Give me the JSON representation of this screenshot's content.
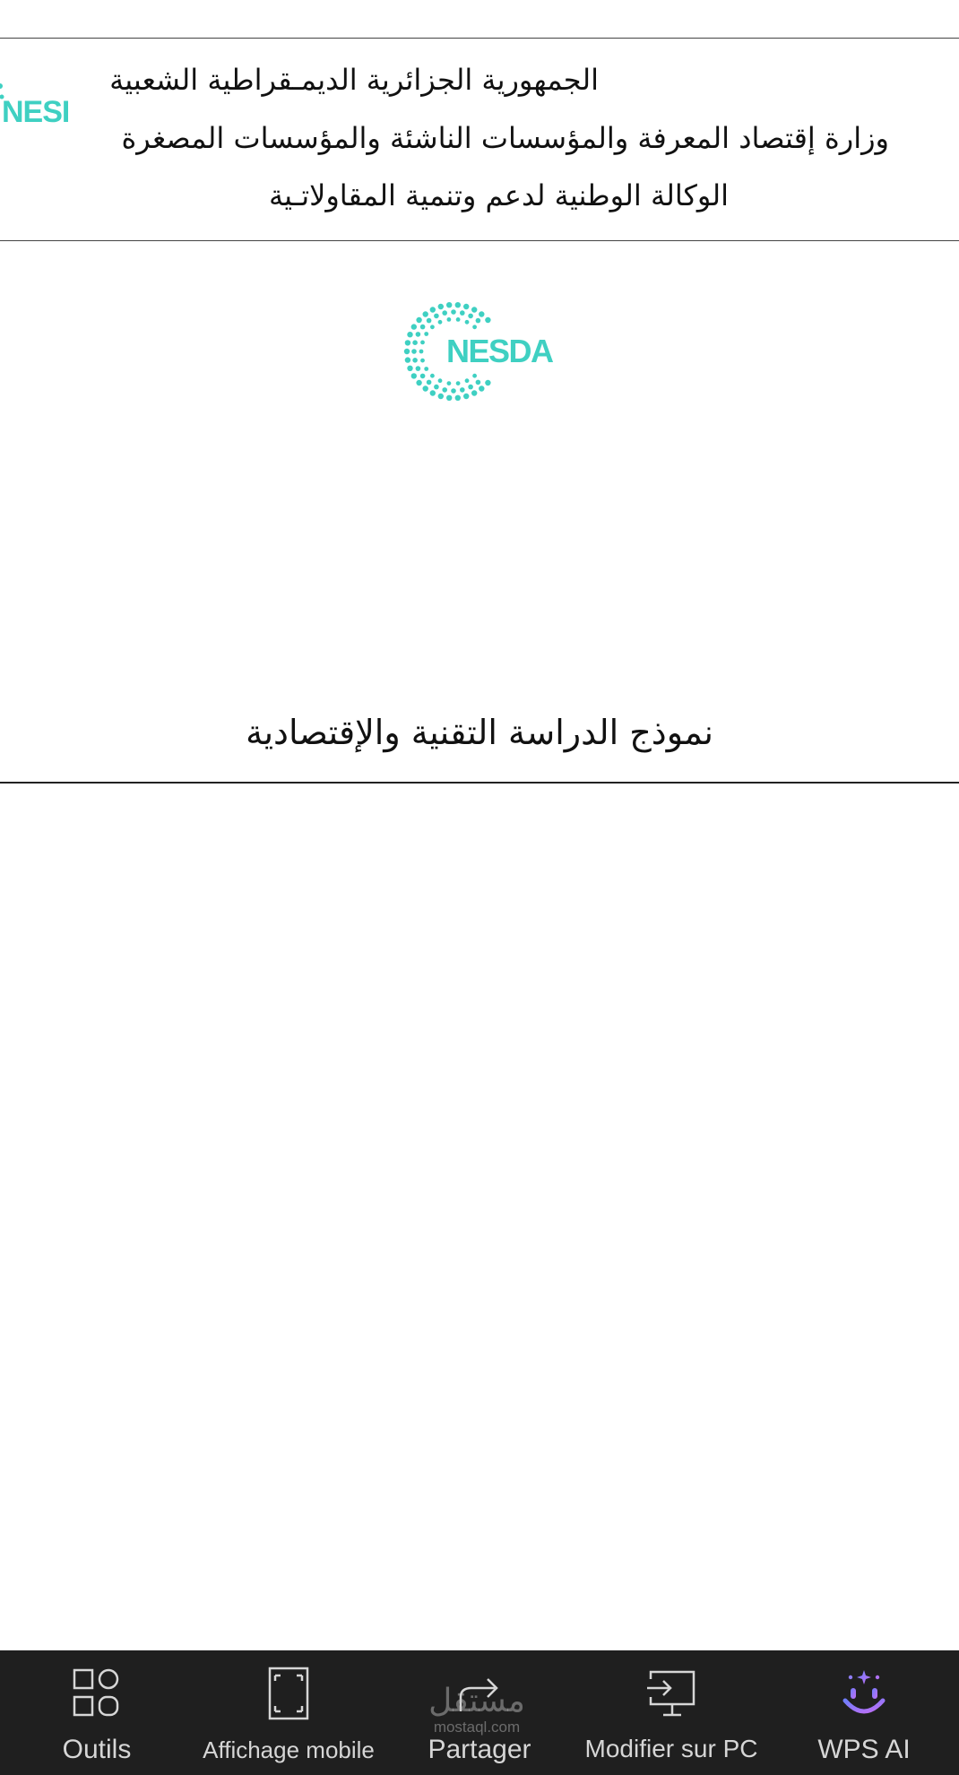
{
  "header": {
    "line1": "الجمهورية الجزائرية الديم‍ـقراطية الشعبية",
    "line2": "وزارة إقتصاد المعرفة والمؤسسات الناشئة والمؤسسات المصغرة",
    "line3": "الوكالة الوطنية لدعم وتنمية المقاولات‍ـية",
    "corner_logo_text": "NESDA"
  },
  "document": {
    "logo_text": "NESDA",
    "title": "نموذج الدراسة التقنية والإقتصادية",
    "brand_color": "#3fd0c2"
  },
  "toolbar": {
    "items": [
      {
        "label": "Outils",
        "icon": "tools-grid-icon"
      },
      {
        "label": "Affichage mobile",
        "icon": "mobile-view-icon"
      },
      {
        "label": "Partager",
        "icon": "share-icon"
      },
      {
        "label": "Modifier sur PC",
        "icon": "edit-on-pc-icon"
      },
      {
        "label": "WPS AI",
        "icon": "wps-ai-icon"
      }
    ]
  },
  "watermark": {
    "arabic": "مستقل",
    "latin": "mostaql.com"
  }
}
